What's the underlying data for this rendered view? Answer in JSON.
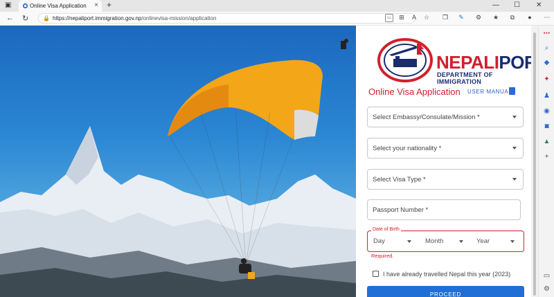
{
  "browser": {
    "tab_title": "Online Visa Application",
    "tab_close": "×",
    "new_tab": "+",
    "url_host": "https://nepaliport.immigration.gov.np",
    "url_path": "/onlinevisa-mission/application",
    "window_controls": {
      "minimize": "—",
      "maximize": "☐",
      "close": "✕"
    }
  },
  "logo": {
    "word_red": "NEPALI",
    "word_blue": "PORT",
    "subtitle": "DEPARTMENT OF IMMIGRATION"
  },
  "form": {
    "title": "Online Visa Application",
    "user_manual": "USER MANUAL",
    "fields": {
      "embassy": "Select Embassy/Consulate/Mission *",
      "nationality": "Select your nationality *",
      "visa_type": "Select Visa Type *",
      "passport": "Passport Number *"
    },
    "dob": {
      "legend": "Date of Birth",
      "day": "Day",
      "month": "Month",
      "year": "Year",
      "error": "Required."
    },
    "travel_checkbox_label": "I have already travelled Nepal this year (2023)",
    "proceed": "PROCEED"
  },
  "colors": {
    "accent_red": "#d1202c",
    "accent_blue": "#1f6fd6",
    "logo_blue": "#1a2c6e"
  },
  "icons": [
    "back-icon",
    "refresh-icon",
    "lock-icon",
    "read-aloud-icon",
    "favorites-icon",
    "extensions-icon",
    "profile-icon",
    "more-icon",
    "search-icon",
    "copilot-icon",
    "settings-icon",
    "user-manual-icon",
    "checkbox-icon"
  ]
}
